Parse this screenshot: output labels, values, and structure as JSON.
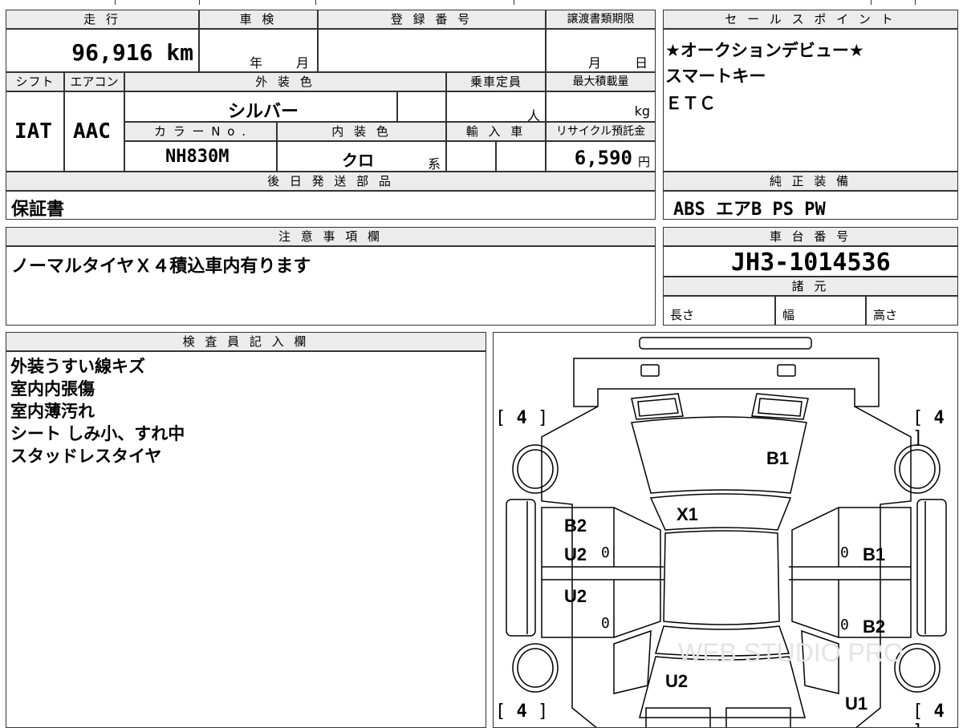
{
  "top_row": {
    "mileage_header": "走 行",
    "mileage_value": "96,916 km",
    "inspection_header": "車 検",
    "inspection_year": "年",
    "inspection_month": "月",
    "registration_header": "登 録 番 号",
    "transfer_header": "譲渡書類期限",
    "transfer_month": "月",
    "transfer_day": "日"
  },
  "second_row": {
    "shift_header": "シフト",
    "shift_value": "IAT",
    "aircon_header": "エアコン",
    "aircon_value": "AAC",
    "exterior_header": "外 装 色",
    "exterior_value": "シルバー",
    "capacity_header": "乗車定員",
    "capacity_unit": "人",
    "maxload_header": "最大積載量",
    "maxload_unit": "kg",
    "color_no_header": "カ ラ ー N o .",
    "color_no_value": "NH830M",
    "interior_header": "内 装 色",
    "interior_value": "クロ",
    "interior_suffix": "系",
    "import_header": "輸 入 車",
    "recycle_header": "リサイクル預託金",
    "recycle_value": "6,590",
    "recycle_unit": "円"
  },
  "later_parts": {
    "header": "後 日 発 送 部 品",
    "value": "保証書"
  },
  "sales_points": {
    "header": "セ ー ル ス ポ イ ン ト",
    "lines": [
      "★オークションデビュー★",
      "スマートキー",
      "ＥＴＣ"
    ]
  },
  "genuine_equipment": {
    "header": "純 正 装 備",
    "value": "ABS エアB PS PW"
  },
  "notes": {
    "header": "注 意 事 項 欄",
    "value": "ノーマルタイヤＸ４積込車内有ります"
  },
  "chassis": {
    "header": "車 台 番 号",
    "value": "JH3-1014536"
  },
  "specs": {
    "header": "諸 元",
    "length": "長さ",
    "width": "幅",
    "height": "高さ"
  },
  "inspector": {
    "header": "検 査 員 記 入 欄",
    "lines": [
      "外装うすい線キズ",
      "室内内張傷",
      "室内薄汚れ",
      "シート しみ小、すれ中",
      "スタッドレスタイヤ"
    ]
  },
  "diagram": {
    "tire_fl": "4",
    "tire_fr": "4",
    "tire_rl": "4",
    "tire_rr": "4",
    "bracket_open": "[",
    "bracket_close": "]",
    "labels": {
      "hood": "B1",
      "windshield": "X1",
      "left_front_door_1": "B2",
      "left_front_door_2": "U2",
      "left_rear_door": "U2",
      "right_front_door": "B1",
      "right_rear_door": "B2",
      "trunk": "U2",
      "rear_right": "U1"
    },
    "zero": "0",
    "watermark": "WEB STUDIO PRO"
  }
}
